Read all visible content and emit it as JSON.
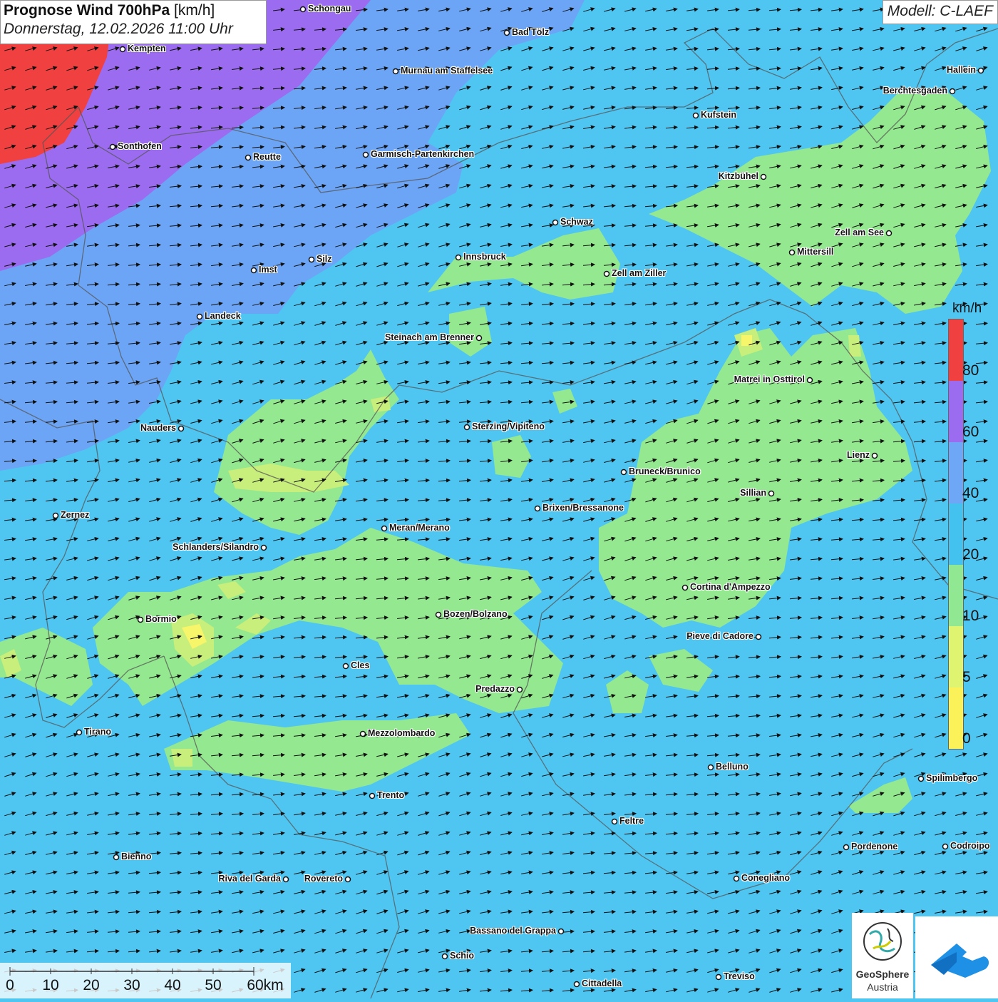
{
  "title": {
    "main": "Prognose Wind 700hPa",
    "unit": "[km/h]",
    "datetime": "Donnerstag, 12.02.2026 11:00 Uhr"
  },
  "model": "Modell: C-LAEF",
  "legend": {
    "unit": "km/h",
    "labels": [
      "80",
      "60",
      "40",
      "20",
      "10",
      "5",
      "0"
    ],
    "colors": [
      "#f04040",
      "#9b6cf0",
      "#6da7f6",
      "#43c1ef",
      "#90e893",
      "#dff571",
      "#fbf25a"
    ]
  },
  "scale_bar": {
    "labels": [
      "0",
      "10",
      "20",
      "30",
      "40",
      "50",
      "60km"
    ]
  },
  "colors": {
    "wind_0_5": "#f7f56a",
    "wind_5_10": "#c8ee7b",
    "wind_10_20": "#94e88f",
    "wind_20_40": "#4fc6f2",
    "wind_40_60": "#6ca5f5",
    "wind_60_80": "#9b6cf0",
    "wind_80_plus": "#f04040"
  },
  "cities": [
    {
      "name": "Schongau"
    },
    {
      "name": "Bad Tölz"
    },
    {
      "name": "Kempten"
    },
    {
      "name": "Murnau am Staffelsee"
    },
    {
      "name": "Hallein"
    },
    {
      "name": "Berchtesgaden"
    },
    {
      "name": "Kufstein"
    },
    {
      "name": "Sonthofen"
    },
    {
      "name": "Reutte"
    },
    {
      "name": "Garmisch-Partenkirchen"
    },
    {
      "name": "Kitzbühel"
    },
    {
      "name": "Schwaz"
    },
    {
      "name": "Zell am See"
    },
    {
      "name": "Mittersill"
    },
    {
      "name": "Innsbruck"
    },
    {
      "name": "Silz"
    },
    {
      "name": "Imst"
    },
    {
      "name": "Zell am Ziller"
    },
    {
      "name": "Landeck"
    },
    {
      "name": "Steinach am Brenner"
    },
    {
      "name": "Matrei in Osttirol"
    },
    {
      "name": "Nauders"
    },
    {
      "name": "Sterzing/Vipiteno"
    },
    {
      "name": "Lienz"
    },
    {
      "name": "Bruneck/Brunico"
    },
    {
      "name": "Sillian"
    },
    {
      "name": "Zernez"
    },
    {
      "name": "Brixen/Bressanone"
    },
    {
      "name": "Meran/Merano"
    },
    {
      "name": "Schlanders/Silandro"
    },
    {
      "name": "Cortina d'Ampezzo"
    },
    {
      "name": "Bozen/Bolzano"
    },
    {
      "name": "Bormio"
    },
    {
      "name": "Pieve di Cadore"
    },
    {
      "name": "Cles"
    },
    {
      "name": "Predazzo"
    },
    {
      "name": "Tirano"
    },
    {
      "name": "Mezzolombardo"
    },
    {
      "name": "Belluno"
    },
    {
      "name": "Spilimbergo"
    },
    {
      "name": "Trento"
    },
    {
      "name": "Feltre"
    },
    {
      "name": "Pordenone"
    },
    {
      "name": "Codroipo"
    },
    {
      "name": "Bienno"
    },
    {
      "name": "Riva del Garda"
    },
    {
      "name": "Rovereto"
    },
    {
      "name": "Conegliano"
    },
    {
      "name": "Bassano del Grappa"
    },
    {
      "name": "Schio"
    },
    {
      "name": "Treviso"
    },
    {
      "name": "Cittadella"
    }
  ],
  "logo": {
    "name": "GeoSphere",
    "sub": "Austria"
  }
}
